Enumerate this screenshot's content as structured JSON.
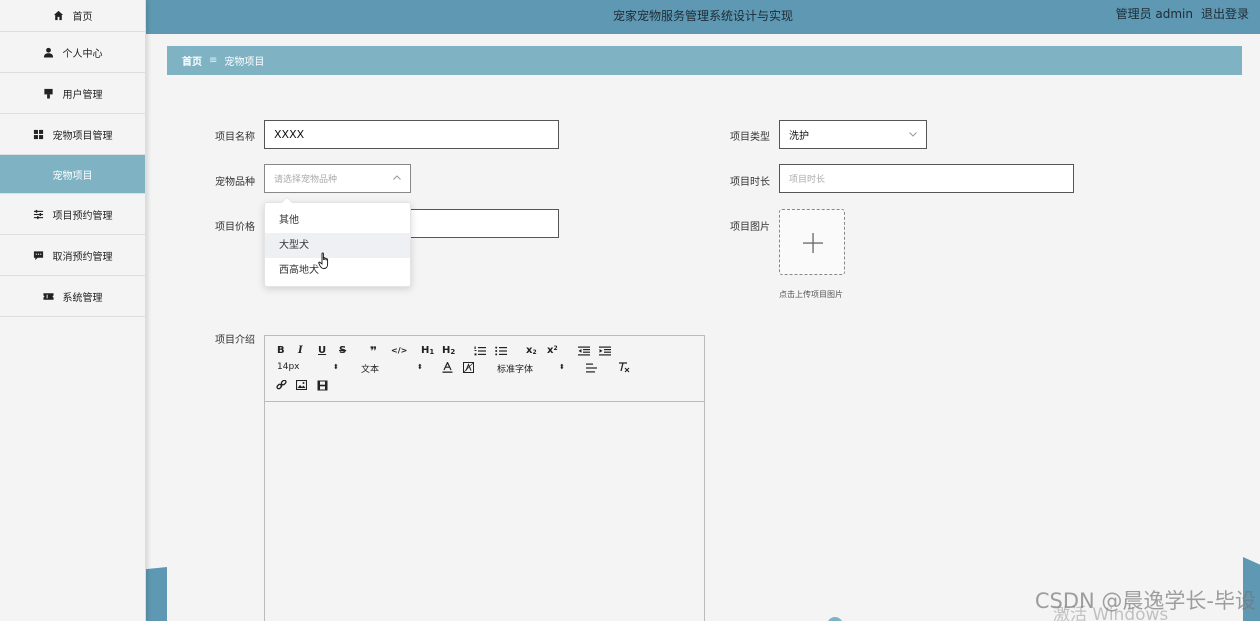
{
  "app": {
    "title": "宠家宠物服务管理系统设计与实现",
    "user_label": "管理员 admin",
    "logout_label": "退出登录"
  },
  "sidebar": {
    "items": [
      {
        "label": "首页",
        "icon": "home-icon"
      },
      {
        "label": "个人中心",
        "icon": "user-icon"
      },
      {
        "label": "用户管理",
        "icon": "user-manage-icon"
      },
      {
        "label": "宠物项目管理",
        "icon": "grid-icon"
      },
      {
        "label": "宠物项目",
        "icon": "",
        "active": true
      },
      {
        "label": "项目预约管理",
        "icon": "sliders-icon"
      },
      {
        "label": "取消预约管理",
        "icon": "message-icon"
      },
      {
        "label": "系统管理",
        "icon": "ticket-icon"
      }
    ]
  },
  "breadcrumb": {
    "home": "首页",
    "separator": "≡",
    "current": "宠物项目"
  },
  "form": {
    "name": {
      "label": "项目名称",
      "value": "XXXX"
    },
    "type": {
      "label": "项目类型",
      "value": "洗护"
    },
    "breed": {
      "label": "宠物品种",
      "placeholder": "请选择宠物品种"
    },
    "duration": {
      "label": "项目时长",
      "placeholder": "项目时长"
    },
    "price": {
      "label": "项目价格"
    },
    "image": {
      "label": "项目图片",
      "tip": "点击上传项目图片"
    },
    "intro": {
      "label": "项目介绍"
    }
  },
  "breed_options": [
    "其他",
    "大型犬",
    "西高地犬"
  ],
  "editor": {
    "row1": [
      "B",
      "I",
      "U",
      "S",
      "❞",
      "</>",
      "H1",
      "H2",
      "ordered-list-icon",
      "bullet-list-icon",
      "x₂",
      "x²",
      "outdent-icon",
      "indent-icon"
    ],
    "size_select": "14px",
    "format_select": "文本",
    "font_select": "标准字体",
    "h1_label": "H",
    "h1_sub": "1",
    "h2_label": "H",
    "h2_sub": "2",
    "sub_label": "x",
    "sub_sub": "2",
    "sup_label": "x",
    "sup_sup": "2"
  },
  "watermark": {
    "csdn": "CSDN @晨逸学长-毕设",
    "windows": "激活 Windows"
  },
  "colors": {
    "topbar": "#5e98b2",
    "accent": "#7fb3c4",
    "background": "#f4f4f4"
  }
}
